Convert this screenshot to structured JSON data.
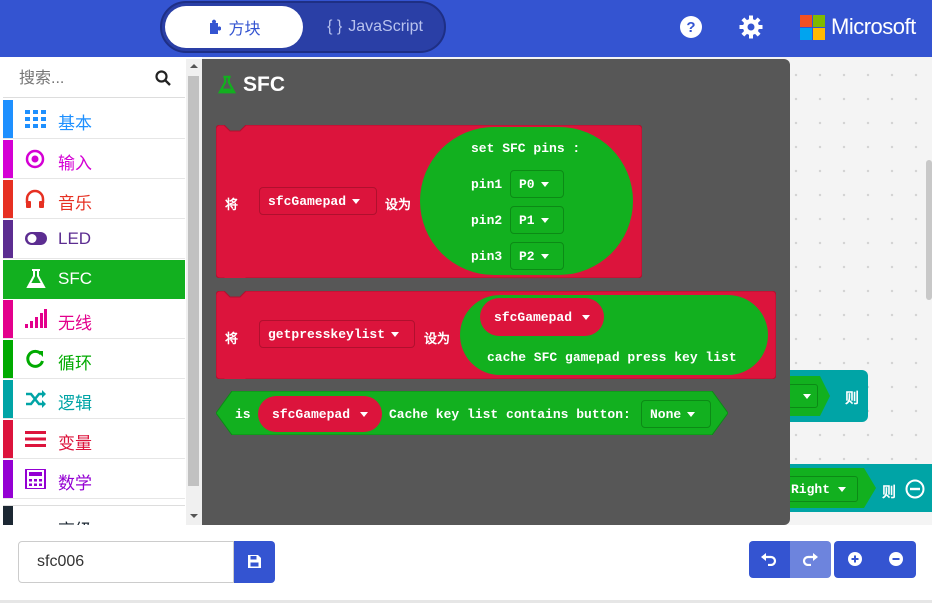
{
  "header": {
    "tab_blocks": "方块",
    "tab_js": "JavaScript",
    "tab_js_icon": "{ }",
    "help_icon": "question-circle-icon",
    "settings_icon": "gear-icon",
    "brand": "Microsoft",
    "colors": {
      "bar": "#3454d1",
      "brand_red": "#f25022",
      "brand_green": "#7fba00",
      "brand_blue": "#00a4ef",
      "brand_yellow": "#ffb900"
    }
  },
  "sidebar": {
    "search_placeholder": "搜索...",
    "categories": [
      {
        "label": "基本",
        "color": "#1e90ff",
        "icon": "grid-icon"
      },
      {
        "label": "输入",
        "color": "#d400d4",
        "icon": "target-icon"
      },
      {
        "label": "音乐",
        "color": "#e63022",
        "icon": "headphones-icon"
      },
      {
        "label": "LED",
        "color": "#5c2d91",
        "icon": "toggle-icon"
      },
      {
        "label": "SFC",
        "color": "#12b01f",
        "icon": "flask-icon",
        "selected": true
      },
      {
        "label": "无线",
        "color": "#e3008c",
        "icon": "signal-bars-icon"
      },
      {
        "label": "循环",
        "color": "#00aa00",
        "icon": "refresh-icon"
      },
      {
        "label": "逻辑",
        "color": "#00a4a6",
        "icon": "shuffle-icon"
      },
      {
        "label": "变量",
        "color": "#dc143c",
        "icon": "list-icon"
      },
      {
        "label": "数学",
        "color": "#9400d3",
        "icon": "calculator-icon"
      },
      {
        "label": "高级",
        "color": "#1c2833",
        "icon": "chevron-down-icon"
      }
    ]
  },
  "flyout": {
    "title": "SFC",
    "block1": {
      "set_word": "将",
      "var": "sfcGamepad",
      "to_word": "设为",
      "func": "set SFC pins :",
      "pins": [
        {
          "name": "pin1",
          "value": "P0"
        },
        {
          "name": "pin2",
          "value": "P1"
        },
        {
          "name": "pin3",
          "value": "P2"
        }
      ]
    },
    "block2": {
      "set_word": "将",
      "var": "getpresskeylist",
      "to_word": "设为",
      "inner_var": "sfcGamepad",
      "func": "cache SFC gamepad press key list"
    },
    "block3": {
      "is_word": "is",
      "var": "sfcGamepad",
      "text": "Cache key list contains button:",
      "button": "None"
    }
  },
  "workspace": {
    "then_1": "则",
    "right_dd": "Right",
    "then_2": "则"
  },
  "footer": {
    "project_name": "sfc006",
    "save_icon": "floppy-disk-icon",
    "undo_icon": "undo-icon",
    "redo_icon": "redo-icon",
    "zoom_in_icon": "zoom-in-icon",
    "zoom_out_icon": "zoom-out-icon"
  }
}
